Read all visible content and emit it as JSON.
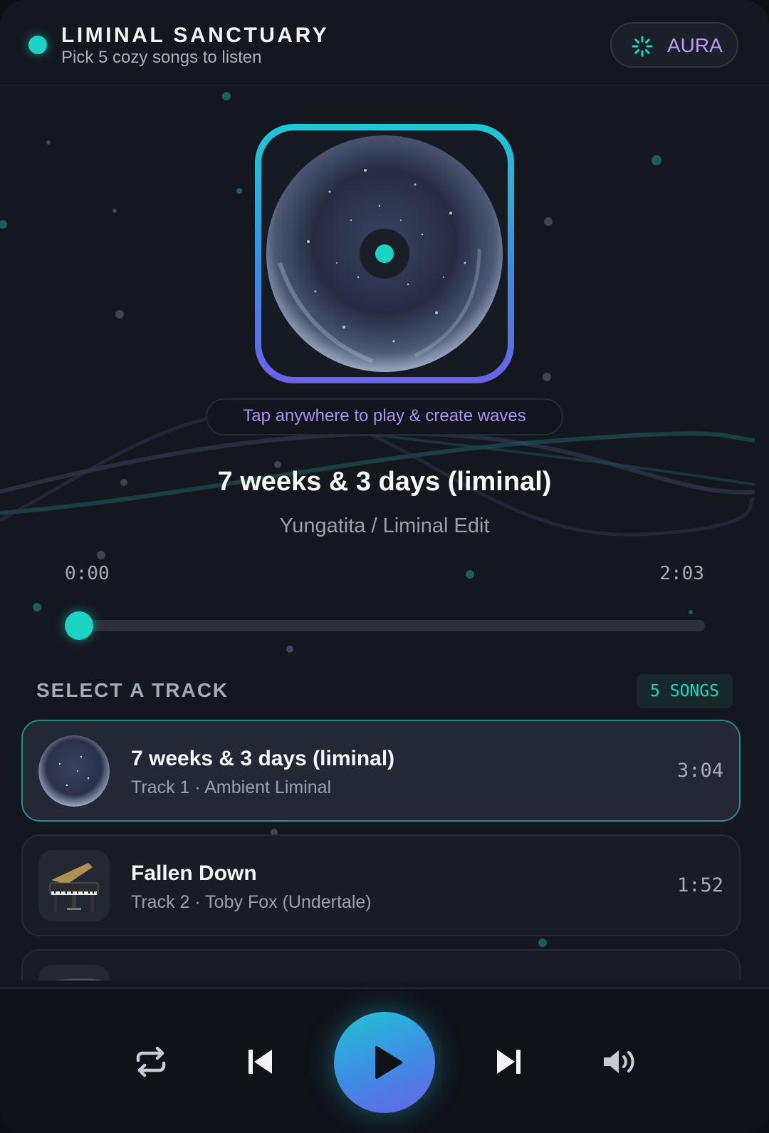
{
  "header": {
    "title": "LIMINAL SANCTUARY",
    "subtitle": "Pick 5 cozy songs to listen",
    "aura_label": "AURA",
    "aura_icon": "sparkle-loader-icon"
  },
  "now_playing": {
    "hint": "Tap anywhere to play & create waves",
    "title": "7 weeks & 3 days (liminal)",
    "artist": "Yungatita / Liminal Edit",
    "elapsed": "0:00",
    "duration": "2:03",
    "progress_fraction": 0.0
  },
  "track_section": {
    "title": "SELECT A TRACK",
    "count_badge": "5 SONGS"
  },
  "tracks": [
    {
      "name": "7 weeks & 3 days (liminal)",
      "meta": "Track 1 · Ambient Liminal",
      "duration": "3:04",
      "active": true,
      "thumb": "cosmic-disc"
    },
    {
      "name": "Fallen Down",
      "meta": "Track 2 · Toby Fox (Undertale)",
      "duration": "1:52",
      "active": false,
      "thumb": "grand-piano"
    }
  ],
  "controls": {
    "repeat_icon": "repeat-icon",
    "prev_icon": "skip-previous-icon",
    "play_icon": "play-icon",
    "next_icon": "skip-next-icon",
    "volume_icon": "volume-icon"
  },
  "colors": {
    "accent": "#1cd3c4",
    "accent_purple": "#a893ee",
    "background": "#14171e"
  }
}
